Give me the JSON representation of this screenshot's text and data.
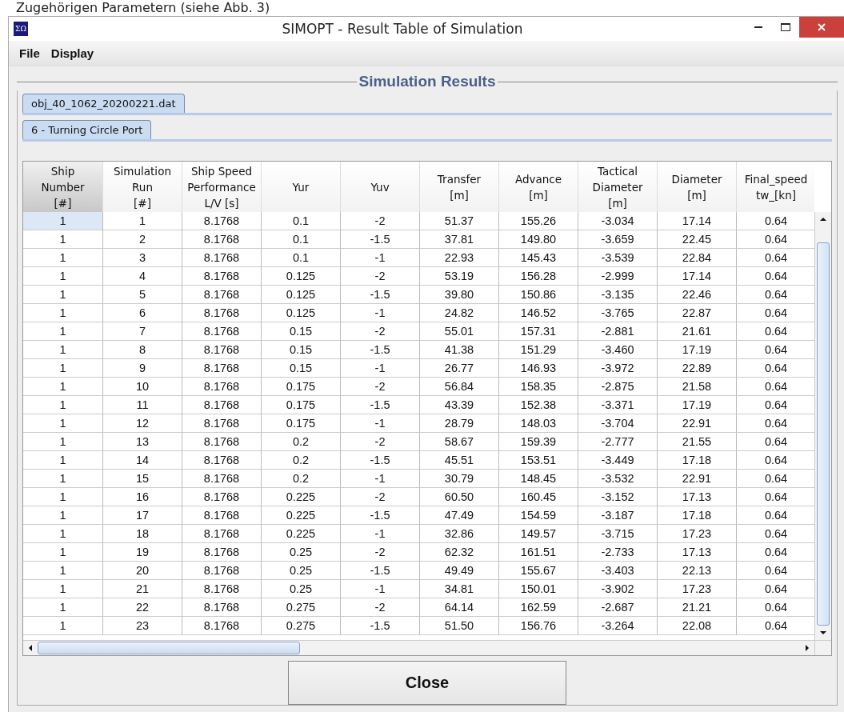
{
  "document_line": "Zugehörigen Parametern (siehe Abb. 3)",
  "window": {
    "icon_text": "ΣΩ",
    "title": "SIMOPT - Result Table of Simulation"
  },
  "menu": [
    "File",
    "Display"
  ],
  "panel": {
    "legend": "Simulation Results"
  },
  "file_tabs": [
    {
      "label": "obj_40_1062_20200221.dat",
      "selected": true
    }
  ],
  "case_tabs": [
    {
      "label": "6 - Turning Circle Port",
      "selected": true
    }
  ],
  "table": {
    "columns": [
      {
        "label": "Ship\nNumber\n[#]",
        "selected": true
      },
      {
        "label": "Simulation\nRun\n[#]",
        "selected": false
      },
      {
        "label": "Ship Speed\nPerformance\nL/V [s]",
        "selected": false
      },
      {
        "label": "Yur",
        "selected": false
      },
      {
        "label": "Yuv",
        "selected": false
      },
      {
        "label": "Transfer\n[m]",
        "selected": false
      },
      {
        "label": "Advance\n[m]",
        "selected": false
      },
      {
        "label": "Tactical\nDiameter\n[m]",
        "selected": false
      },
      {
        "label": "Diameter\n[m]",
        "selected": false
      },
      {
        "label": "Final_speed\ntw_[kn]",
        "selected": false
      }
    ],
    "rows": [
      {
        "selected": true,
        "cells": [
          "1",
          "1",
          "8.1768",
          "0.1",
          "-2",
          "51.37",
          "155.26",
          "-3.034",
          "17.14",
          "0.64"
        ]
      },
      {
        "selected": false,
        "cells": [
          "1",
          "2",
          "8.1768",
          "0.1",
          "-1.5",
          "37.81",
          "149.80",
          "-3.659",
          "22.45",
          "0.64"
        ]
      },
      {
        "selected": false,
        "cells": [
          "1",
          "3",
          "8.1768",
          "0.1",
          "-1",
          "22.93",
          "145.43",
          "-3.539",
          "22.84",
          "0.64"
        ]
      },
      {
        "selected": false,
        "cells": [
          "1",
          "4",
          "8.1768",
          "0.125",
          "-2",
          "53.19",
          "156.28",
          "-2.999",
          "17.14",
          "0.64"
        ]
      },
      {
        "selected": false,
        "cells": [
          "1",
          "5",
          "8.1768",
          "0.125",
          "-1.5",
          "39.80",
          "150.86",
          "-3.135",
          "22.46",
          "0.64"
        ]
      },
      {
        "selected": false,
        "cells": [
          "1",
          "6",
          "8.1768",
          "0.125",
          "-1",
          "24.82",
          "146.52",
          "-3.765",
          "22.87",
          "0.64"
        ]
      },
      {
        "selected": false,
        "cells": [
          "1",
          "7",
          "8.1768",
          "0.15",
          "-2",
          "55.01",
          "157.31",
          "-2.881",
          "21.61",
          "0.64"
        ]
      },
      {
        "selected": false,
        "cells": [
          "1",
          "8",
          "8.1768",
          "0.15",
          "-1.5",
          "41.38",
          "151.29",
          "-3.460",
          "17.19",
          "0.64"
        ]
      },
      {
        "selected": false,
        "cells": [
          "1",
          "9",
          "8.1768",
          "0.15",
          "-1",
          "26.77",
          "146.93",
          "-3.972",
          "22.89",
          "0.64"
        ]
      },
      {
        "selected": false,
        "cells": [
          "1",
          "10",
          "8.1768",
          "0.175",
          "-2",
          "56.84",
          "158.35",
          "-2.875",
          "21.58",
          "0.64"
        ]
      },
      {
        "selected": false,
        "cells": [
          "1",
          "11",
          "8.1768",
          "0.175",
          "-1.5",
          "43.39",
          "152.38",
          "-3.371",
          "17.19",
          "0.64"
        ]
      },
      {
        "selected": false,
        "cells": [
          "1",
          "12",
          "8.1768",
          "0.175",
          "-1",
          "28.79",
          "148.03",
          "-3.704",
          "22.91",
          "0.64"
        ]
      },
      {
        "selected": false,
        "cells": [
          "1",
          "13",
          "8.1768",
          "0.2",
          "-2",
          "58.67",
          "159.39",
          "-2.777",
          "21.55",
          "0.64"
        ]
      },
      {
        "selected": false,
        "cells": [
          "1",
          "14",
          "8.1768",
          "0.2",
          "-1.5",
          "45.51",
          "153.51",
          "-3.449",
          "17.18",
          "0.64"
        ]
      },
      {
        "selected": false,
        "cells": [
          "1",
          "15",
          "8.1768",
          "0.2",
          "-1",
          "30.79",
          "148.45",
          "-3.532",
          "22.91",
          "0.64"
        ]
      },
      {
        "selected": false,
        "cells": [
          "1",
          "16",
          "8.1768",
          "0.225",
          "-2",
          "60.50",
          "160.45",
          "-3.152",
          "17.13",
          "0.64"
        ]
      },
      {
        "selected": false,
        "cells": [
          "1",
          "17",
          "8.1768",
          "0.225",
          "-1.5",
          "47.49",
          "154.59",
          "-3.187",
          "17.18",
          "0.64"
        ]
      },
      {
        "selected": false,
        "cells": [
          "1",
          "18",
          "8.1768",
          "0.225",
          "-1",
          "32.86",
          "149.57",
          "-3.715",
          "17.23",
          "0.64"
        ]
      },
      {
        "selected": false,
        "cells": [
          "1",
          "19",
          "8.1768",
          "0.25",
          "-2",
          "62.32",
          "161.51",
          "-2.733",
          "17.13",
          "0.64"
        ]
      },
      {
        "selected": false,
        "cells": [
          "1",
          "20",
          "8.1768",
          "0.25",
          "-1.5",
          "49.49",
          "155.67",
          "-3.403",
          "22.13",
          "0.64"
        ]
      },
      {
        "selected": false,
        "cells": [
          "1",
          "21",
          "8.1768",
          "0.25",
          "-1",
          "34.81",
          "150.01",
          "-3.902",
          "17.23",
          "0.64"
        ]
      },
      {
        "selected": false,
        "cells": [
          "1",
          "22",
          "8.1768",
          "0.275",
          "-2",
          "64.14",
          "162.59",
          "-2.687",
          "21.21",
          "0.64"
        ]
      },
      {
        "selected": false,
        "cells": [
          "1",
          "23",
          "8.1768",
          "0.275",
          "-1.5",
          "51.50",
          "156.76",
          "-3.264",
          "22.08",
          "0.64"
        ]
      }
    ]
  },
  "buttons": [
    {
      "label": "Close"
    }
  ]
}
